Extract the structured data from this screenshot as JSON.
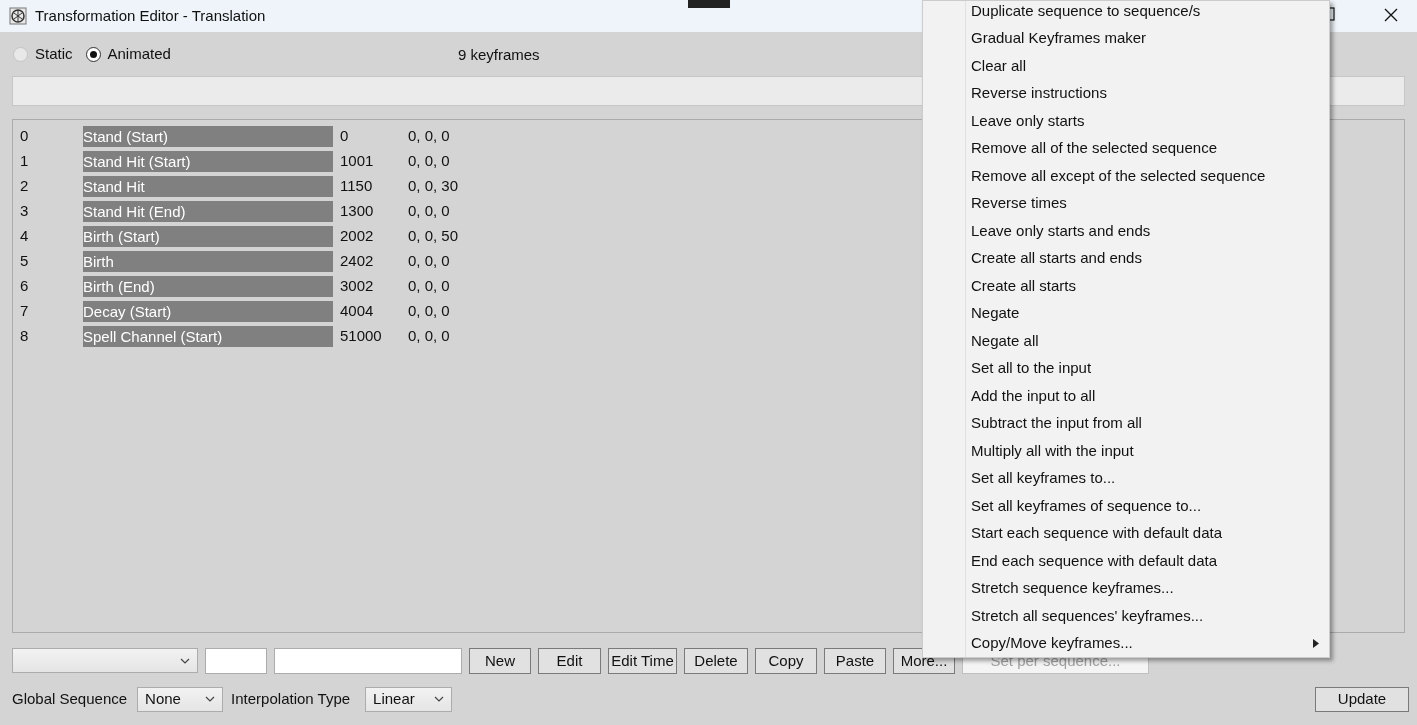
{
  "window": {
    "title": "Transformation Editor - Translation"
  },
  "mode_options": [
    {
      "label": "Static",
      "selected": false
    },
    {
      "label": "Animated",
      "selected": true
    }
  ],
  "keyframe_count": "9 keyframes",
  "keyframes": [
    {
      "index": "0",
      "sequence": "Stand (Start)",
      "time": "0",
      "value": "0, 0, 0"
    },
    {
      "index": "1",
      "sequence": "Stand Hit (Start)",
      "time": "1001",
      "value": "0, 0, 0"
    },
    {
      "index": "2",
      "sequence": "Stand Hit",
      "time": "1150",
      "value": "0, 0, 30"
    },
    {
      "index": "3",
      "sequence": "Stand Hit (End)",
      "time": "1300",
      "value": "0, 0, 0"
    },
    {
      "index": "4",
      "sequence": "Birth (Start)",
      "time": "2002",
      "value": "0, 0, 50"
    },
    {
      "index": "5",
      "sequence": "Birth",
      "time": "2402",
      "value": "0, 0, 0"
    },
    {
      "index": "6",
      "sequence": "Birth (End)",
      "time": "3002",
      "value": "0, 0, 0"
    },
    {
      "index": "7",
      "sequence": "Decay (Start)",
      "time": "4004",
      "value": "0, 0, 0"
    },
    {
      "index": "8",
      "sequence": "Spell Channel (Start)",
      "time": "51000",
      "value": "0, 0, 0"
    }
  ],
  "buttons": [
    {
      "label": "New",
      "disabled": false
    },
    {
      "label": "Edit",
      "disabled": false
    },
    {
      "label": "Edit Time",
      "disabled": false
    },
    {
      "label": "Delete",
      "disabled": false
    },
    {
      "label": "Copy",
      "disabled": false
    },
    {
      "label": "Paste",
      "disabled": false
    },
    {
      "label": "More...",
      "disabled": false
    },
    {
      "label": "Set per sequence...",
      "disabled": true
    }
  ],
  "global_sequence": {
    "label": "Global Sequence",
    "value": "None"
  },
  "interpolation_type": {
    "label": "Interpolation Type",
    "value": "Linear"
  },
  "update_button": "Update",
  "context_menu": [
    {
      "label": "Duplicate sequence to sequence/s",
      "submenu": false
    },
    {
      "label": "Gradual Keyframes maker",
      "submenu": false
    },
    {
      "label": "Clear all",
      "submenu": false
    },
    {
      "label": "Reverse instructions",
      "submenu": false
    },
    {
      "label": "Leave only starts",
      "submenu": false
    },
    {
      "label": "Remove all of the selected sequence",
      "submenu": false
    },
    {
      "label": "Remove all except of the selected sequence",
      "submenu": false
    },
    {
      "label": "Reverse times",
      "submenu": false
    },
    {
      "label": "Leave only starts and ends",
      "submenu": false
    },
    {
      "label": "Create all starts and ends",
      "submenu": false
    },
    {
      "label": "Create all starts",
      "submenu": false
    },
    {
      "label": "Negate",
      "submenu": false
    },
    {
      "label": "Negate all",
      "submenu": false
    },
    {
      "label": "Set all to the input",
      "submenu": false
    },
    {
      "label": "Add the input to all",
      "submenu": false
    },
    {
      "label": "Subtract the input from all",
      "submenu": false
    },
    {
      "label": "Multiply all with the input",
      "submenu": false
    },
    {
      "label": "Set all keyframes to...",
      "submenu": false
    },
    {
      "label": "Set all keyframes of sequence to...",
      "submenu": false
    },
    {
      "label": "Start each sequence with default data",
      "submenu": false
    },
    {
      "label": "End each sequence with default data",
      "submenu": false
    },
    {
      "label": "Stretch sequence keyframes...",
      "submenu": false
    },
    {
      "label": "Stretch all sequences' keyframes...",
      "submenu": false
    },
    {
      "label": "Copy/Move keyframes...",
      "submenu": true
    }
  ]
}
